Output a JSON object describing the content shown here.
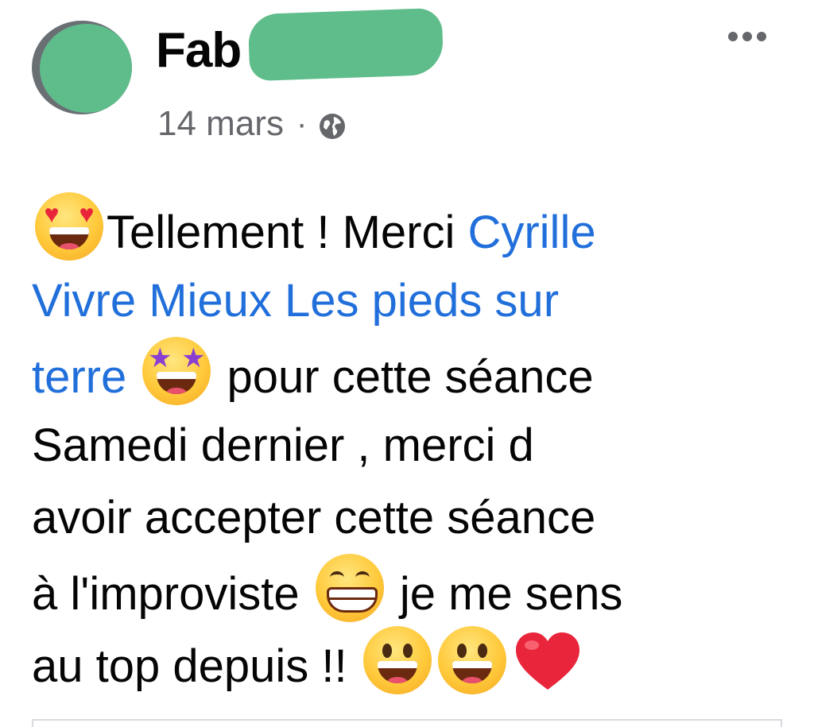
{
  "post": {
    "author": {
      "name_visible": "Fab",
      "avatar_icon": "user-avatar-icon",
      "redaction_color": "#5fbd8b"
    },
    "meta": {
      "date": "14 mars",
      "separator": "·",
      "audience_icon": "globe-icon"
    },
    "more_icon": "more-options-icon",
    "text": {
      "line1_text": "Tellement ! Merci ",
      "line1_mention": "Cyrille",
      "line2_mention": "Vivre Mieux  Les pieds sur",
      "line3_mention": "terre",
      "line3_text": " pour cette séance",
      "line4_text": "Samedi dernier , merci d",
      "line5_text": "avoir accepter cette séance",
      "line6_text": "à l'improviste",
      "line6_text_after": " je me sens",
      "line7_text": "au top depuis !! "
    },
    "emojis": [
      "heart-eyes-emoji",
      "star-struck-emoji",
      "grinning-squinting-emoji",
      "grinning-face-emoji",
      "grinning-face-emoji",
      "red-heart-emoji"
    ],
    "colors": {
      "text": "#050505",
      "secondary": "#65676b",
      "mention": "#216fdb"
    }
  }
}
